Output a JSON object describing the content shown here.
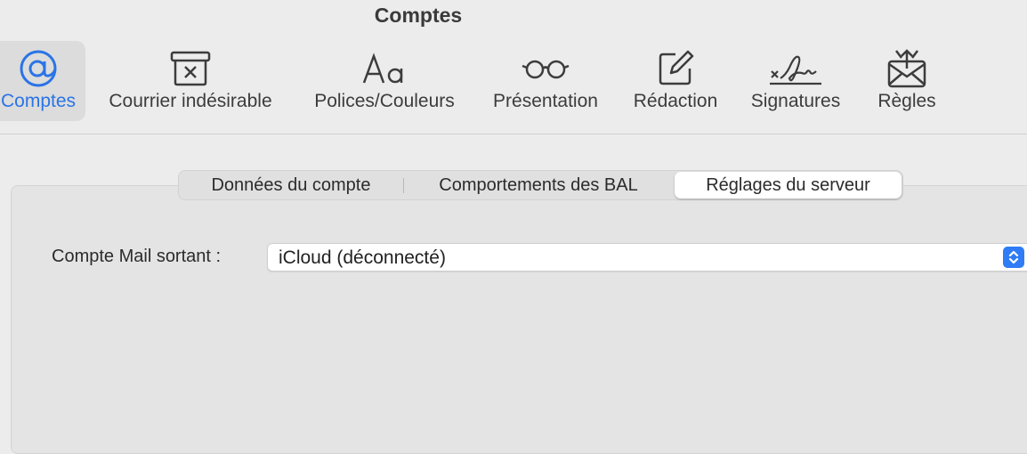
{
  "window": {
    "title": "Comptes"
  },
  "toolbar": {
    "items": [
      {
        "label": "Comptes",
        "icon": "at-sign-icon",
        "selected": true
      },
      {
        "label": "Courrier indésirable",
        "icon": "junk-bin-icon",
        "selected": false
      },
      {
        "label": "Polices/Couleurs",
        "icon": "font-aa-icon",
        "selected": false
      },
      {
        "label": "Présentation",
        "icon": "glasses-icon",
        "selected": false
      },
      {
        "label": "Rédaction",
        "icon": "compose-icon",
        "selected": false
      },
      {
        "label": "Signatures",
        "icon": "signature-icon",
        "selected": false
      },
      {
        "label": "Règles",
        "icon": "rules-envelope-icon",
        "selected": false
      }
    ]
  },
  "tabs": {
    "items": [
      {
        "label": "Données du compte",
        "active": false
      },
      {
        "label": "Comportements des BAL",
        "active": false
      },
      {
        "label": "Réglages du serveur",
        "active": true
      }
    ]
  },
  "form": {
    "outgoing_label": "Compte Mail sortant :",
    "outgoing_value": "iCloud (déconnecté)"
  },
  "colors": {
    "accent": "#2a74e6",
    "background": "#ececec",
    "selected_tool_bg": "#dcdcdc"
  }
}
